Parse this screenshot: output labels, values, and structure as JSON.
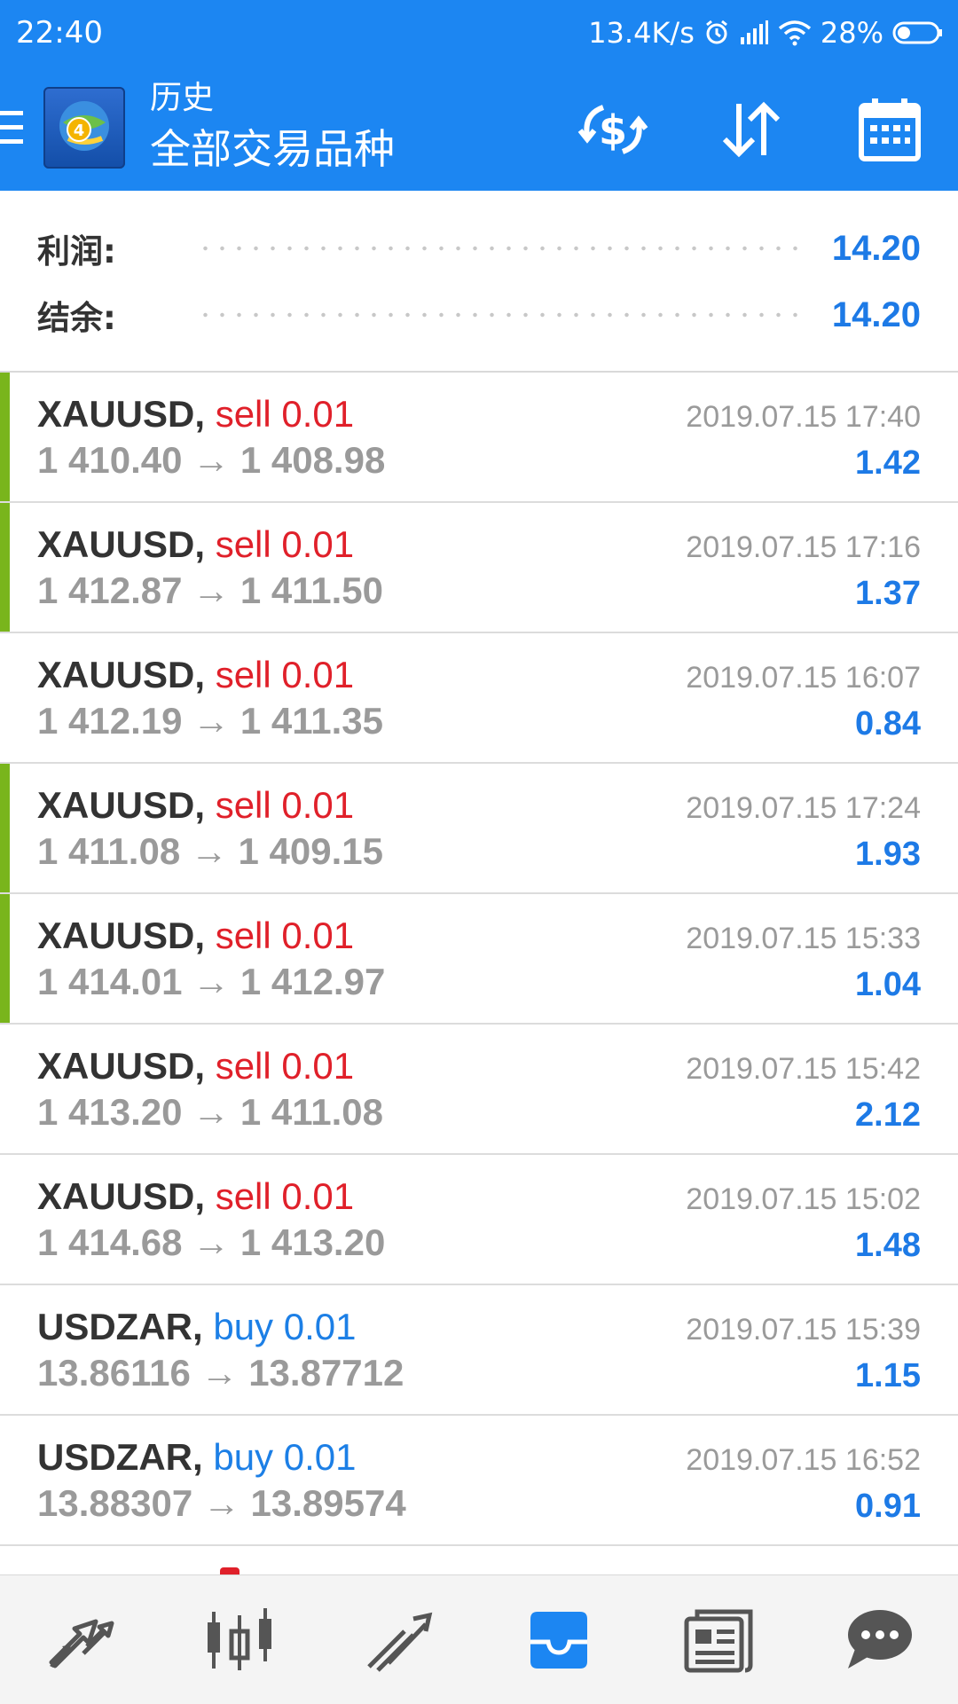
{
  "status_bar": {
    "time": "22:40",
    "network_speed": "13.4K/s",
    "battery": "28%",
    "icons": [
      "alarm-icon",
      "signal-icon",
      "wifi-icon",
      "battery-icon"
    ]
  },
  "app_bar": {
    "title_top": "历史",
    "title_main": "全部交易品种",
    "actions": [
      "currency-exchange-icon",
      "sort-icon",
      "calendar-icon"
    ]
  },
  "summary": {
    "profit_label": "利润:",
    "profit_value": "14.20",
    "balance_label": "结余:",
    "balance_value": "14.20"
  },
  "trades": [
    {
      "symbol": "XAUUSD,",
      "side": "sell",
      "side_text": "sell 0.01",
      "prices": "1 410.40 → 1 408.98",
      "time": "2019.07.15 17:40",
      "profit": "1.42",
      "accent": true
    },
    {
      "symbol": "XAUUSD,",
      "side": "sell",
      "side_text": "sell 0.01",
      "prices": "1 412.87 → 1 411.50",
      "time": "2019.07.15 17:16",
      "profit": "1.37",
      "accent": true
    },
    {
      "symbol": "XAUUSD,",
      "side": "sell",
      "side_text": "sell 0.01",
      "prices": "1 412.19 → 1 411.35",
      "time": "2019.07.15 16:07",
      "profit": "0.84",
      "accent": false
    },
    {
      "symbol": "XAUUSD,",
      "side": "sell",
      "side_text": "sell 0.01",
      "prices": "1 411.08 → 1 409.15",
      "time": "2019.07.15 17:24",
      "profit": "1.93",
      "accent": true
    },
    {
      "symbol": "XAUUSD,",
      "side": "sell",
      "side_text": "sell 0.01",
      "prices": "1 414.01 → 1 412.97",
      "time": "2019.07.15 15:33",
      "profit": "1.04",
      "accent": true
    },
    {
      "symbol": "XAUUSD,",
      "side": "sell",
      "side_text": "sell 0.01",
      "prices": "1 413.20 → 1 411.08",
      "time": "2019.07.15 15:42",
      "profit": "2.12",
      "accent": false
    },
    {
      "symbol": "XAUUSD,",
      "side": "sell",
      "side_text": "sell 0.01",
      "prices": "1 414.68 → 1 413.20",
      "time": "2019.07.15 15:02",
      "profit": "1.48",
      "accent": false
    },
    {
      "symbol": "USDZAR,",
      "side": "buy",
      "side_text": "buy 0.01",
      "prices": "13.86116 → 13.87712",
      "time": "2019.07.15 15:39",
      "profit": "1.15",
      "accent": false
    },
    {
      "symbol": "USDZAR,",
      "side": "buy",
      "side_text": "buy 0.01",
      "prices": "13.88307 → 13.89574",
      "time": "2019.07.15 16:52",
      "profit": "0.91",
      "accent": false
    }
  ],
  "bottom_nav": {
    "items": [
      "trade-icon",
      "chart-candles-icon",
      "chart-trend-icon",
      "history-inbox-icon",
      "news-icon",
      "chat-icon"
    ],
    "active": "history-inbox-icon",
    "active_color": "#1c86f2",
    "inactive_color": "#555555"
  },
  "colors": {
    "primary": "#1c86f2",
    "profit": "#1d7ae6",
    "sell": "#e0202a",
    "buy": "#1c7fe6",
    "accent_bar": "#79b51c"
  }
}
